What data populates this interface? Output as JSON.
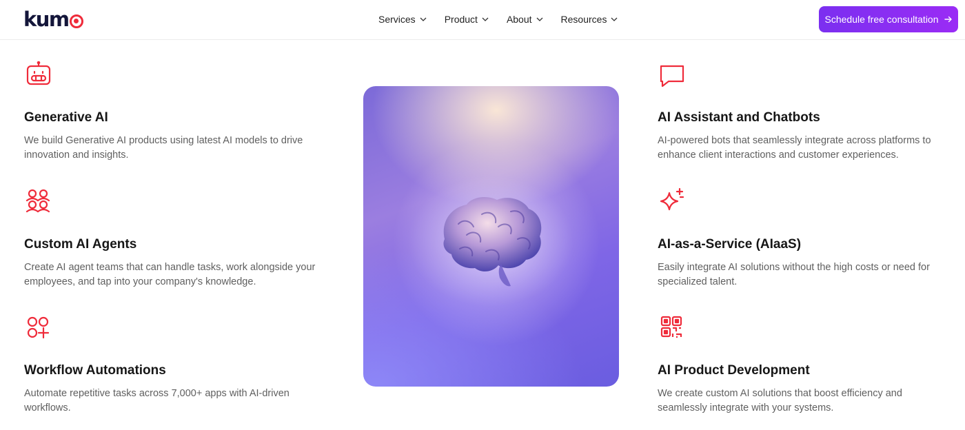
{
  "header": {
    "logo_text": "kum",
    "nav": [
      {
        "label": "Services"
      },
      {
        "label": "Product"
      },
      {
        "label": "About"
      },
      {
        "label": "Resources"
      }
    ],
    "cta_label": "Schedule free consultation"
  },
  "colors": {
    "accent_red": "#ef2b3a",
    "cta_purple": "#7b2ff0"
  },
  "features_left": [
    {
      "icon": "robot-icon",
      "title": "Generative AI",
      "desc": "We build Generative AI products using latest AI models to drive innovation and insights."
    },
    {
      "icon": "users-icon",
      "title": "Custom AI Agents",
      "desc": "Create AI agent teams that can handle tasks, work alongside your employees, and tap into your company's knowledge."
    },
    {
      "icon": "apps-add-icon",
      "title": "Workflow Automations",
      "desc": "Automate repetitive tasks across 7,000+ apps with AI-driven workflows."
    }
  ],
  "features_right": [
    {
      "icon": "chat-bubble-icon",
      "title": "AI Assistant and Chatbots",
      "desc": "AI-powered bots that seamlessly integrate across platforms to enhance client interactions and customer experiences."
    },
    {
      "icon": "sparkles-icon",
      "title": "AI-as-a-Service (AIaaS)",
      "desc": "Easily integrate AI solutions without the high costs or need for specialized talent."
    },
    {
      "icon": "qr-code-icon",
      "title": "AI Product Development",
      "desc": "We create custom AI solutions that boost efficiency and seamlessly integrate with your systems."
    }
  ]
}
